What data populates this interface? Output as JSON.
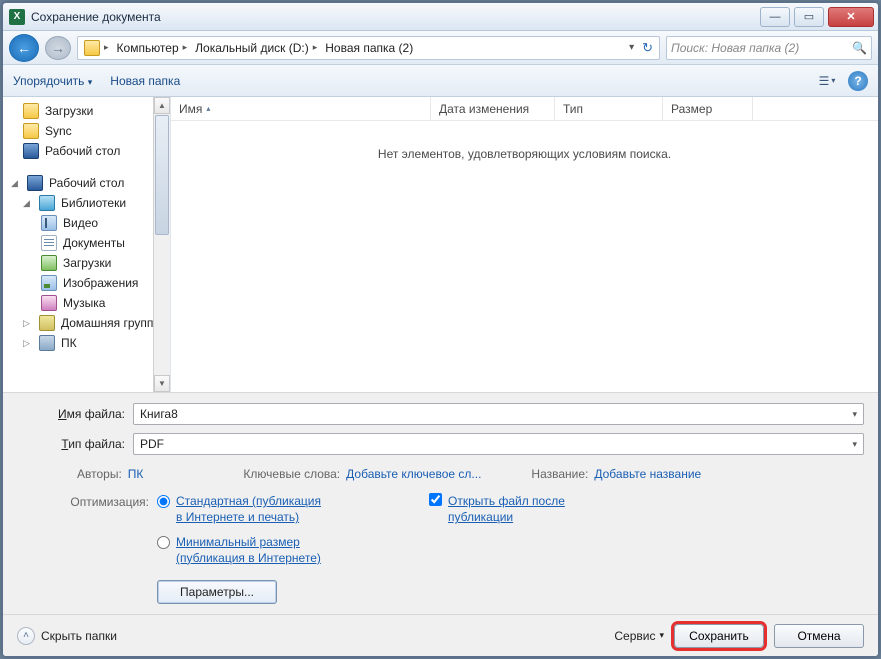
{
  "window": {
    "title": "Сохранение документа"
  },
  "breadcrumb": {
    "items": [
      "Компьютер",
      "Локальный диск (D:)",
      "Новая папка (2)"
    ]
  },
  "search": {
    "placeholder": "Поиск: Новая папка (2)"
  },
  "toolbar": {
    "organize": "Упорядочить",
    "newfolder": "Новая папка"
  },
  "sidebar": {
    "downloads": "Загрузки",
    "sync": "Sync",
    "desktop1": "Рабочий стол",
    "desktop2": "Рабочий стол",
    "libraries": "Библиотеки",
    "video": "Видео",
    "documents": "Документы",
    "downloads2": "Загрузки",
    "images": "Изображения",
    "music": "Музыка",
    "homegroup": "Домашняя групп",
    "pc": "ПК"
  },
  "columns": {
    "name": "Имя",
    "date": "Дата изменения",
    "type": "Тип",
    "size": "Размер"
  },
  "empty": "Нет элементов, удовлетворяющих условиям поиска.",
  "form": {
    "filename_label": "Имя файла:",
    "filename_value": "Книга8",
    "filetype_label": "Тип файла:",
    "filetype_value": "PDF",
    "authors_label": "Авторы:",
    "authors_value": "ПК",
    "keywords_label": "Ключевые слова:",
    "keywords_value": "Добавьте ключевое сл...",
    "title_label": "Название:",
    "title_value": "Добавьте название",
    "optimize_label": "Оптимизация:",
    "radio_standard": "Стандартная (публикация в Интернете и печать)",
    "radio_minimal": "Минимальный размер (публикация в Интернете)",
    "open_after": "Открыть файл после публикации",
    "params_btn": "Параметры..."
  },
  "footer": {
    "hide": "Скрыть папки",
    "service": "Сервис",
    "save": "Сохранить",
    "cancel": "Отмена"
  }
}
